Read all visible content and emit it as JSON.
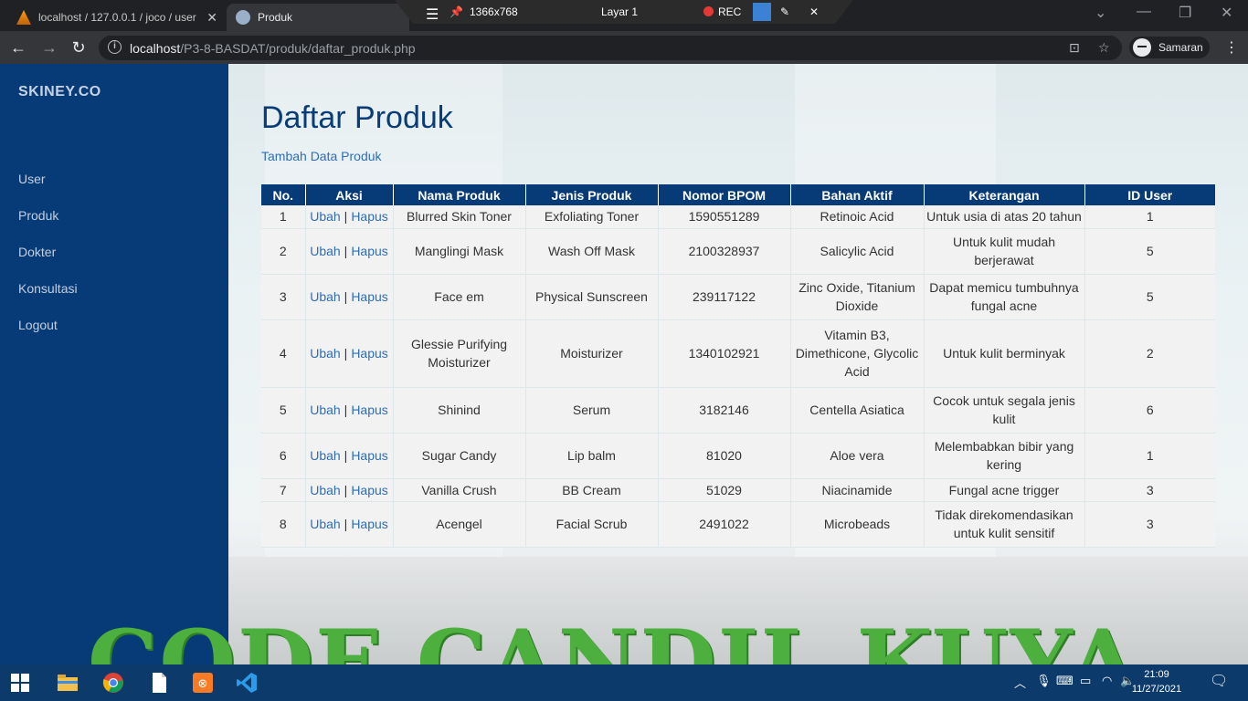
{
  "browser": {
    "tabs": [
      {
        "title": "localhost / 127.0.0.1 / joco / user"
      },
      {
        "title": "Produk"
      }
    ],
    "recorder": {
      "resolution": "1366x768",
      "layer": "Layar 1",
      "rec_label": "REC"
    },
    "url_host": "localhost",
    "url_path": "/P3-8-BASDAT/produk/daftar_produk.php",
    "profile_label": "Samaran"
  },
  "sidebar": {
    "brand": "SKINEY.CO",
    "items": [
      {
        "label": "User"
      },
      {
        "label": "Produk"
      },
      {
        "label": "Dokter"
      },
      {
        "label": "Konsultasi"
      },
      {
        "label": "Logout"
      }
    ]
  },
  "main": {
    "title": "Daftar Produk",
    "add_link": "Tambah Data Produk",
    "table": {
      "headers": [
        "No.",
        "Aksi",
        "Nama Produk",
        "Jenis Produk",
        "Nomor BPOM",
        "Bahan Aktif",
        "Keterangan",
        "ID User"
      ],
      "edit_label": "Ubah",
      "separator": "|",
      "delete_label": "Hapus",
      "rows": [
        {
          "no": "1",
          "nama": "Blurred Skin Toner",
          "jenis": "Exfoliating Toner",
          "bpom": "1590551289",
          "bahan": "Retinoic Acid",
          "ket": "Untuk usia di atas 20 tahun",
          "id_user": "1"
        },
        {
          "no": "2",
          "nama": "Manglingi Mask",
          "jenis": "Wash Off Mask",
          "bpom": "2100328937",
          "bahan": "Salicylic Acid",
          "ket": "Untuk kulit mudah berjerawat",
          "id_user": "5"
        },
        {
          "no": "3",
          "nama": "Face em",
          "jenis": "Physical Sunscreen",
          "bpom": "239117122",
          "bahan": "Zinc Oxide, Titanium Dioxide",
          "ket": "Dapat memicu tumbuhnya fungal acne",
          "id_user": "5"
        },
        {
          "no": "4",
          "nama": "Glessie Purifying Moisturizer",
          "jenis": "Moisturizer",
          "bpom": "1340102921",
          "bahan": "Vitamin B3, Dimethicone, Glycolic Acid",
          "ket": "Untuk kulit berminyak",
          "id_user": "2"
        },
        {
          "no": "5",
          "nama": "Shinind",
          "jenis": "Serum",
          "bpom": "3182146",
          "bahan": "Centella Asiatica",
          "ket": "Cocok untuk segala jenis kulit",
          "id_user": "6"
        },
        {
          "no": "6",
          "nama": "Sugar Candy",
          "jenis": "Lip balm",
          "bpom": "81020",
          "bahan": "Aloe vera",
          "ket": "Melembabkan bibir yang kering",
          "id_user": "1"
        },
        {
          "no": "7",
          "nama": "Vanilla Crush",
          "jenis": "BB Cream",
          "bpom": "51029",
          "bahan": "Niacinamide",
          "ket": "Fungal acne trigger",
          "id_user": "3"
        },
        {
          "no": "8",
          "nama": "Acengel",
          "jenis": "Facial Scrub",
          "bpom": "2491022",
          "bahan": "Microbeads",
          "ket": "Tidak direkomendasikan untuk kulit sensitif",
          "id_user": "3"
        }
      ]
    }
  },
  "watermark": "CODE CANDIL KUYA",
  "taskbar": {
    "time": "21:09",
    "date": "11/27/2021"
  },
  "colors": {
    "sidebar": "#073b78",
    "header": "#073b78",
    "link": "#2e6db8",
    "watermark": "#4caf3e"
  }
}
